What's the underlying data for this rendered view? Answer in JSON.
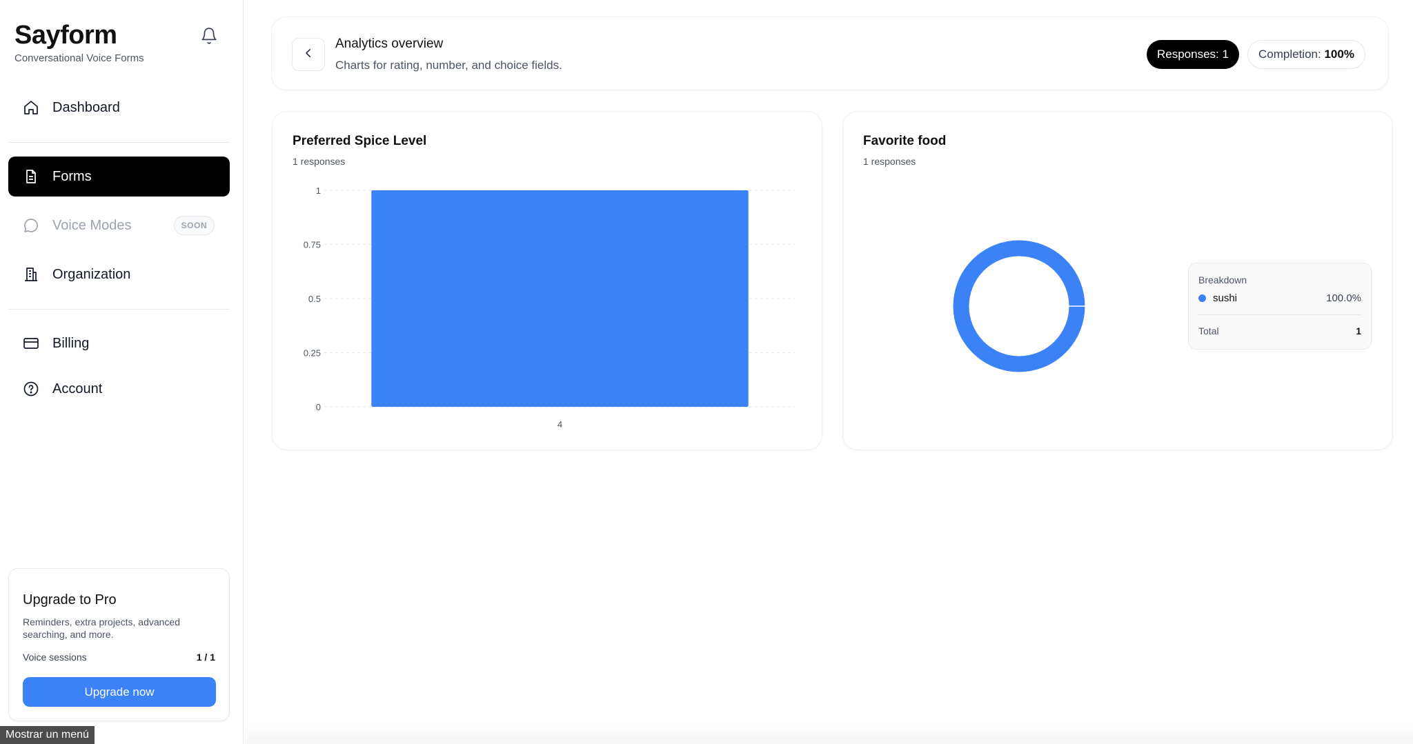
{
  "brand": {
    "title": "Sayform",
    "subtitle": "Conversational Voice Forms"
  },
  "sidebar": {
    "items": [
      {
        "label": "Dashboard",
        "icon": "home-icon"
      },
      {
        "label": "Forms",
        "icon": "document-icon",
        "active": true
      },
      {
        "label": "Voice Modes",
        "icon": "chat-bubble-icon",
        "badge": "SOON",
        "disabled": true
      },
      {
        "label": "Organization",
        "icon": "building-icon"
      },
      {
        "label": "Billing",
        "icon": "credit-card-icon"
      },
      {
        "label": "Account",
        "icon": "help-circle-icon"
      }
    ]
  },
  "upgrade": {
    "title": "Upgrade to Pro",
    "description": "Reminders, extra projects, advanced searching, and more.",
    "usage_label": "Voice sessions",
    "usage_value": "1 / 1",
    "button_label": "Upgrade now"
  },
  "tooltip": "Mostrar un menú",
  "header": {
    "title": "Analytics overview",
    "subtitle": "Charts for rating, number, and choice fields.",
    "responses_pill": "Responses: 1",
    "completion_label": "Completion:",
    "completion_value": "100%"
  },
  "colors": {
    "accent": "#3b82f6",
    "active_nav": "#000000"
  },
  "chart_data": [
    {
      "type": "bar",
      "title": "Preferred Spice Level",
      "subtitle": "1 responses",
      "categories": [
        "4"
      ],
      "values": [
        1
      ],
      "ylim": [
        0,
        1
      ],
      "yticks": [
        "0",
        "0.25",
        "0.5",
        "0.75",
        "1"
      ],
      "grid": true
    },
    {
      "type": "pie",
      "title": "Favorite food",
      "subtitle": "1 responses",
      "categories": [
        "sushi"
      ],
      "values": [
        1
      ],
      "legend": {
        "heading": "Breakdown",
        "items": [
          {
            "label": "sushi",
            "percent": "100.0%"
          }
        ],
        "total_label": "Total",
        "total_value": "1"
      }
    }
  ]
}
